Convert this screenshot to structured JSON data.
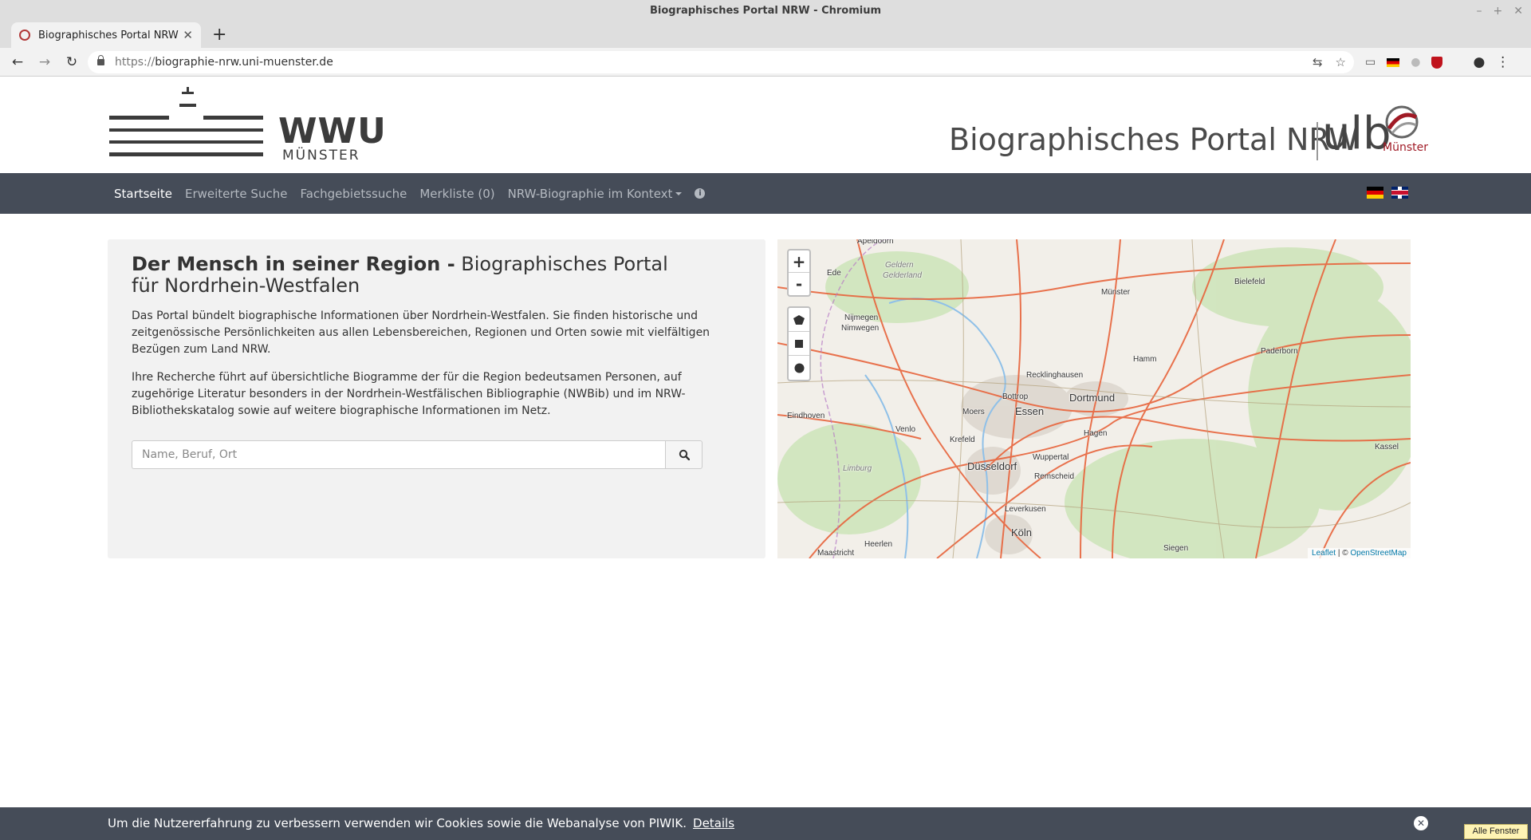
{
  "window": {
    "title": "Biographisches Portal NRW - Chromium"
  },
  "tab": {
    "title": "Biographisches Portal NRW"
  },
  "address": {
    "scheme": "https://",
    "host": "biographie-nrw.uni-muenster.de"
  },
  "header": {
    "logo_text": "WWU",
    "logo_sub": "MÜNSTER",
    "portal_title": "Biographisches Portal NRW",
    "ulb_text": "ulb",
    "ulb_sub": "Münster"
  },
  "nav": {
    "items": [
      {
        "label": "Startseite"
      },
      {
        "label": "Erweiterte Suche"
      },
      {
        "label": "Fachgebietssuche"
      },
      {
        "label": "Merkliste (0)"
      },
      {
        "label": "NRW-Biographie im Kontext"
      }
    ]
  },
  "intro": {
    "heading_bold": "Der Mensch in seiner Region -",
    "heading_rest": "Biographisches Portal für Nordrhein-Westfalen",
    "paragraph1": "Das Portal bündelt biographische Informationen über Nordrhein-Westfalen. Sie finden historische und zeitgenössische Persönlichkeiten aus allen Lebensbereichen, Regionen und Orten sowie mit vielfältigen Bezügen zum Land NRW.",
    "paragraph2": "Ihre Recherche führt auf übersichtliche Biogramme der für die Region bedeutsamen Personen, auf zugehörige Literatur besonders in der Nordrhein-Westfälischen Bibliographie (NWBib) und im NRW-Bibliothekskatalog sowie auf weitere biographische Informationen im Netz.",
    "search_placeholder": "Name, Beruf, Ort"
  },
  "map": {
    "zoom_in": "+",
    "zoom_out": "-",
    "attribution_leaflet": "Leaflet",
    "attribution_sep": " | © ",
    "attribution_osm": "OpenStreetMap",
    "cities": [
      {
        "name": "Apeldoorn"
      },
      {
        "name": "Gelderland"
      },
      {
        "name": "Geldern"
      },
      {
        "name": "Ede"
      },
      {
        "name": "Münster"
      },
      {
        "name": "Bielefeld"
      },
      {
        "name": "Nijmegen"
      },
      {
        "name": "Nimwegen"
      },
      {
        "name": "Paderborn"
      },
      {
        "name": "Hamm"
      },
      {
        "name": "Recklinghausen"
      },
      {
        "name": "Bottrop"
      },
      {
        "name": "Dortmund"
      },
      {
        "name": "Eindhoven"
      },
      {
        "name": "Moers"
      },
      {
        "name": "Essen"
      },
      {
        "name": "Hagen"
      },
      {
        "name": "Venlo"
      },
      {
        "name": "Krefeld"
      },
      {
        "name": "Wuppertal"
      },
      {
        "name": "Kassel"
      },
      {
        "name": "Limburg"
      },
      {
        "name": "Düsseldorf"
      },
      {
        "name": "Remscheid"
      },
      {
        "name": "Leverkusen"
      },
      {
        "name": "Köln"
      },
      {
        "name": "Heerlen"
      },
      {
        "name": "Siegen"
      },
      {
        "name": "Maastricht"
      }
    ]
  },
  "cookie": {
    "text": "Um die Nutzererfahrung zu verbessern verwenden wir Cookies sowie die Webanalyse von PIWIK.",
    "details": "Details"
  },
  "taskbar": {
    "all_windows": "Alle Fenster"
  },
  "colors": {
    "navbar": "#454c58",
    "intro_bg": "#f2f2f2",
    "map_road": "#e8643c",
    "link": "#0078a8"
  }
}
